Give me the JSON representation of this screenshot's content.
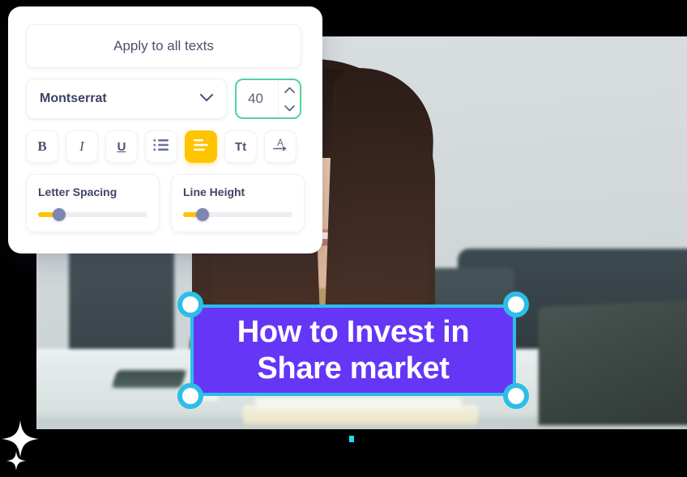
{
  "panel": {
    "apply_button_label": "Apply to all texts",
    "font": {
      "selected": "Montserrat",
      "dropdown_icon": "chevron-down-icon"
    },
    "font_size": {
      "value": "40",
      "increment_icon": "chevron-up-icon",
      "decrement_icon": "chevron-down-icon",
      "border_color": "#52D3A2"
    },
    "toolbar": {
      "active_color": "#FFC400",
      "buttons": [
        {
          "name": "bold",
          "label": "B",
          "icon": "bold-icon",
          "active": false
        },
        {
          "name": "italic",
          "label": "I",
          "icon": "italic-icon",
          "active": false
        },
        {
          "name": "underline",
          "label": "U",
          "icon": "underline-icon",
          "active": false
        },
        {
          "name": "numbered-list",
          "label": "",
          "icon": "numbered-list-icon",
          "active": false
        },
        {
          "name": "align-left",
          "label": "",
          "icon": "align-left-icon",
          "active": true
        },
        {
          "name": "text-case",
          "label": "Tt",
          "icon": "text-case-icon",
          "active": false
        },
        {
          "name": "text-direction",
          "label": "A",
          "icon": "text-direction-icon",
          "active": false
        }
      ]
    },
    "sliders": [
      {
        "name": "letter-spacing",
        "label": "Letter Spacing",
        "fill_percent": 17,
        "thumb_percent": 17
      },
      {
        "name": "line-height",
        "label": "Line Height",
        "fill_percent": 16,
        "thumb_percent": 16
      }
    ]
  },
  "canvas": {
    "text_element": {
      "content": "How to Invest in\nShare market",
      "background_color": "#6536F5",
      "text_color": "#ffffff"
    },
    "selection": {
      "color": "#2CBEE8",
      "handles": [
        "top-left",
        "top-right",
        "bottom-left",
        "bottom-right"
      ]
    }
  }
}
